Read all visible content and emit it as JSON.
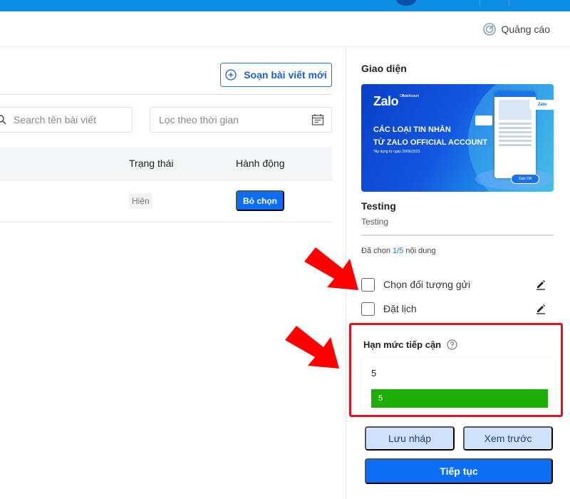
{
  "topbar": {
    "color": "#0d8de3"
  },
  "subheader": {
    "ads_label": "Quảng cáo",
    "ads_icon": "target-icon"
  },
  "main": {
    "compose_button": {
      "label": "Soạn bài viết mới",
      "icon": "plus-circle-icon"
    },
    "search": {
      "placeholder": "Search tên bài viết",
      "icon": "search-icon"
    },
    "date_filter": {
      "placeholder": "Lọc theo thời gian",
      "icon": "calendar-icon"
    },
    "table": {
      "columns": [
        "Trạng thái",
        "Hành động"
      ],
      "rows": [
        {
          "status": "Hiện",
          "action": "Bỏ chọn"
        }
      ]
    }
  },
  "panel": {
    "section_title": "Giao diện",
    "banner": {
      "logo": "Zalo",
      "logo_sub": "Official Account",
      "line1": "CÁC LOẠI TIN NHẮN",
      "line2": "TỪ ZALO OFFICIAL ACCOUNT",
      "line3": "*Áp dụng từ ngày 20/06/2023",
      "bubble": "Zalo",
      "button": "Zalo OA"
    },
    "name": "Testing",
    "description": "Testing",
    "selected_prefix": "Đã chọn ",
    "selected_count": "1/5",
    "selected_suffix": " nội dung",
    "options": [
      {
        "label": "Chọn đối tượng gửi",
        "checked": false
      },
      {
        "label": "Đặt lịch",
        "checked": false
      }
    ],
    "quota": {
      "title": "Hạn mức tiếp cận",
      "value": "5",
      "bar_label": "5",
      "bar_fill_fraction": 1.0,
      "bar_color": "#1fad07"
    },
    "buttons": {
      "draft": "Lưu nháp",
      "preview": "Xem trước",
      "continue": "Tiếp tục"
    }
  },
  "annotations": {
    "arrow_color": "#ff0000",
    "highlight_color": "#e0141e"
  }
}
